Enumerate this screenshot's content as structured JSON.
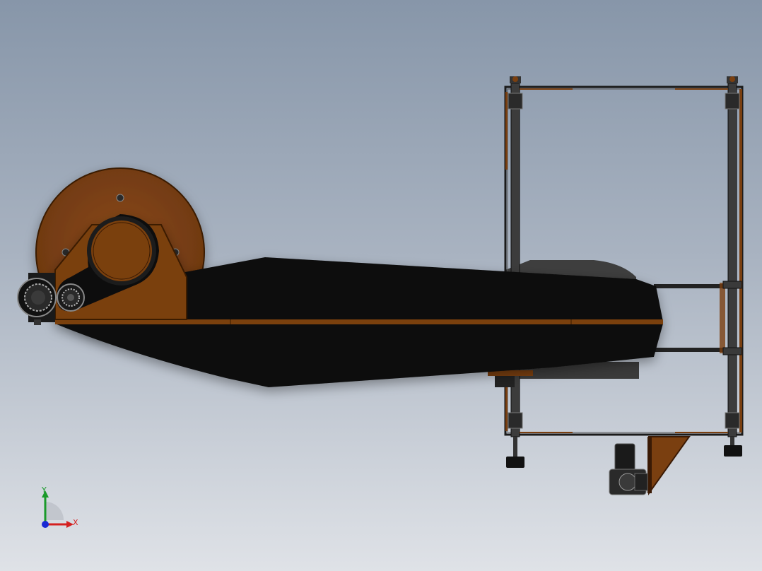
{
  "view": {
    "background_top": "#8796a9",
    "background_bottom": "#dfe2e7"
  },
  "model": {
    "part_colors": {
      "body": "#0b0b0b",
      "plate": "#7a3f10",
      "plate_edge": "#3a1a05",
      "frame_bar": "#2d2d2d",
      "shadow_panel": "#3b3b3b"
    },
    "icons": [
      "drum-wheel-icon",
      "bearing-icon",
      "boom-arm-icon",
      "frame-icon",
      "motor-icon"
    ]
  },
  "triad": {
    "x_label": "X",
    "y_label": "Y",
    "x_color": "#d42020",
    "y_color": "#1a9a2a",
    "z_color": "#1a2ad4"
  }
}
